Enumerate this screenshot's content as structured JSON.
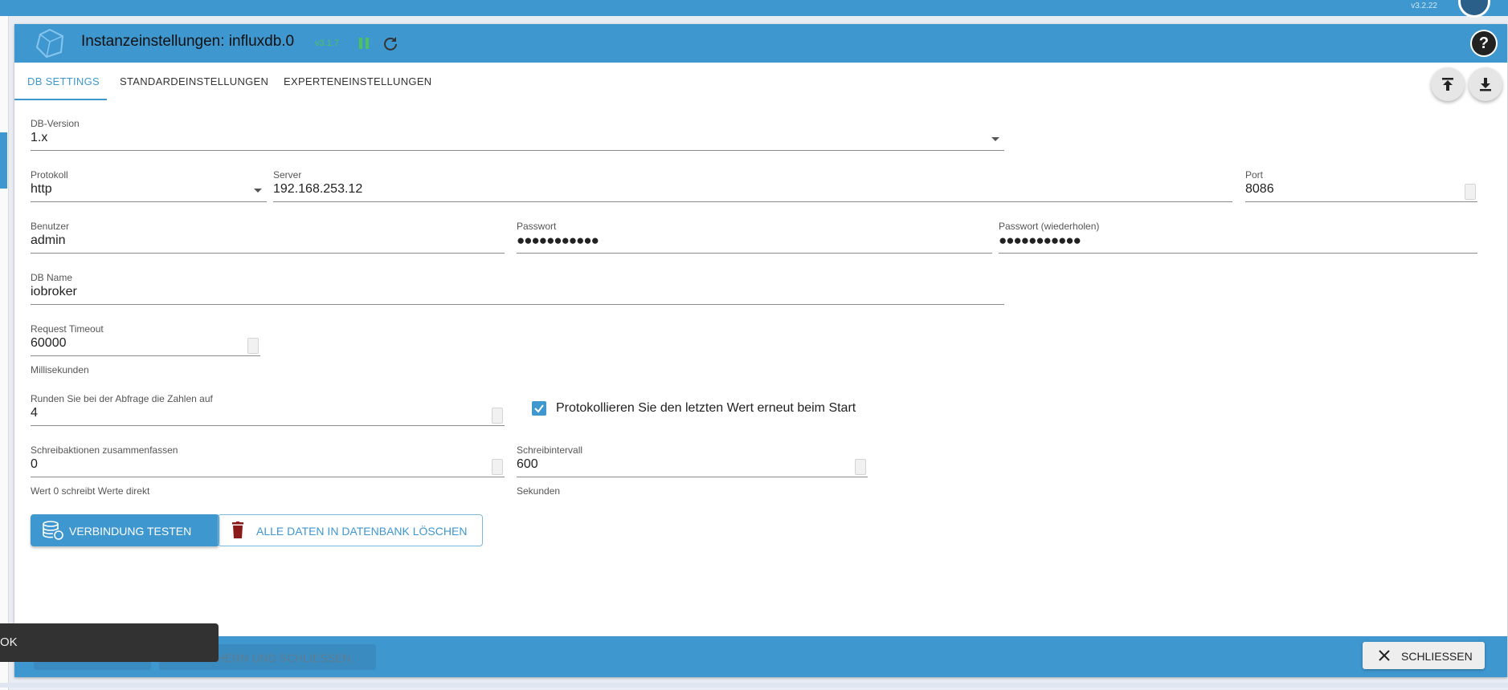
{
  "topbar": {
    "version": "v3.2.22"
  },
  "dialog": {
    "title": "Instanzeinstellungen: influxdb.0",
    "version": "v3.1.7",
    "help_label": "?"
  },
  "tabs": [
    {
      "label": "DB SETTINGS",
      "active": true
    },
    {
      "label": "STANDARDEINSTELLUNGEN",
      "active": false
    },
    {
      "label": "EXPERTENEINSTELLUNGEN",
      "active": false
    }
  ],
  "form": {
    "db_version": {
      "label": "DB-Version",
      "value": "1.x"
    },
    "protocol": {
      "label": "Protokoll",
      "value": "http"
    },
    "server": {
      "label": "Server",
      "value": "192.168.253.12"
    },
    "port": {
      "label": "Port",
      "value": "8086"
    },
    "user": {
      "label": "Benutzer",
      "value": "admin"
    },
    "password": {
      "label": "Passwort",
      "value": "●●●●●●●●●●●"
    },
    "password_repeat": {
      "label": "Passwort (wiederholen)",
      "value": "●●●●●●●●●●●"
    },
    "db_name": {
      "label": "DB Name",
      "value": "iobroker"
    },
    "request_timeout": {
      "label": "Request Timeout",
      "value": "60000",
      "helper": "Millisekunden"
    },
    "round": {
      "label": "Runden Sie bei der Abfrage die Zahlen auf",
      "value": "4"
    },
    "log_last_value": {
      "label": "Protokollieren Sie den letzten Wert erneut beim Start",
      "checked": true
    },
    "batch": {
      "label": "Schreibaktionen zusammenfassen",
      "value": "0",
      "helper": "Wert 0 schreibt Werte direkt"
    },
    "write_interval": {
      "label": "Schreibintervall",
      "value": "600",
      "helper": "Sekunden"
    }
  },
  "buttons": {
    "test_connection": "VERBINDUNG TESTEN",
    "delete_all": "ALLE DATEN IN DATENBANK LÖSCHEN"
  },
  "footer": {
    "save_close": "ICHERN UND SCHLIESSEN",
    "close": "SCHLIESSEN"
  },
  "snackbar": {
    "text": "OK"
  },
  "colors": {
    "accent": "#3f97cf",
    "version_green": "#4ec35a",
    "delete_red": "#8b1a1a"
  }
}
